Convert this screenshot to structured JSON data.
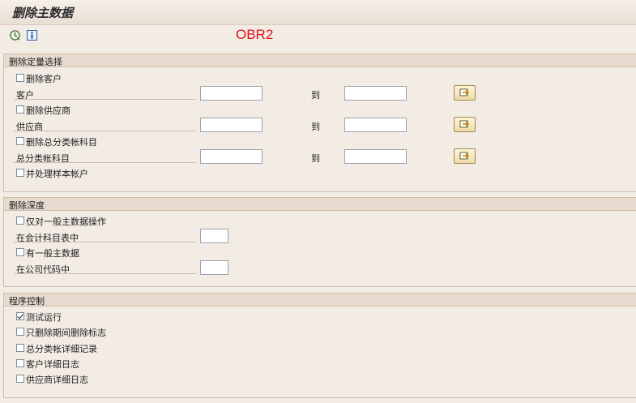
{
  "window": {
    "title": "删除主数据",
    "tcode": "OBR2"
  },
  "toolbar": {
    "execute_icon": "execute-clock-icon",
    "info_icon": "info-icon"
  },
  "selection": {
    "title": "删除定量选择",
    "delete_customers": {
      "label": "删除客户",
      "checked": false
    },
    "customer": {
      "label": "客户",
      "from": "",
      "to_label": "到",
      "to": ""
    },
    "delete_vendors": {
      "label": "删除供应商",
      "checked": false
    },
    "vendor": {
      "label": "供应商",
      "from": "",
      "to_label": "到",
      "to": ""
    },
    "delete_gl": {
      "label": "删除总分类帐科目",
      "checked": false
    },
    "gl_account": {
      "label": "总分类帐科目",
      "from": "",
      "to_label": "到",
      "to": ""
    },
    "sample_accounts": {
      "label": "并处理样本帐户",
      "checked": false
    },
    "multi_select_icon": "multiple-selection-arrow-icon"
  },
  "depth": {
    "title": "删除深度",
    "general_only": {
      "label": "仅对一般主数据操作",
      "checked": false
    },
    "in_chart_of_accounts": {
      "label": "在会计科目表中",
      "value": ""
    },
    "with_general": {
      "label": "有一般主数据",
      "checked": false
    },
    "in_company_code": {
      "label": "在公司代码中",
      "value": ""
    }
  },
  "control": {
    "title": "程序控制",
    "test_run": {
      "label": "测试运行",
      "checked": true
    },
    "only_deletion_flag": {
      "label": "只删除期间删除标志",
      "checked": false
    },
    "gl_detail_log": {
      "label": "总分类帐详细记录",
      "checked": false
    },
    "customer_detail_log": {
      "label": "客户详细日志",
      "checked": false
    },
    "vendor_detail_log": {
      "label": "供应商详细日志",
      "checked": false
    }
  }
}
